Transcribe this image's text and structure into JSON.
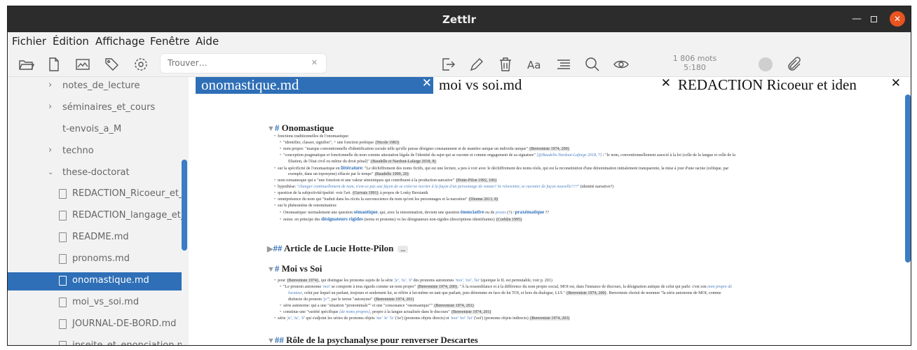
{
  "window": {
    "title": "Zettlr"
  },
  "menu": [
    "Fichier",
    "Édition",
    "Affichage",
    "Fenêtre",
    "Aide"
  ],
  "toolbar": {
    "search_placeholder": "Trouver…",
    "word_count": "1 806 mots",
    "char_count": "5:180",
    "icons": [
      "folder-open-icon",
      "new-file-icon",
      "graph-icon",
      "tags-icon",
      "settings-icon",
      "export-icon",
      "edit-icon",
      "trash-icon",
      "font-icon",
      "toc-icon",
      "search-icon",
      "preview-eye-icon",
      "attachments-icon"
    ]
  },
  "sidebar": {
    "items": [
      {
        "label": "notes_de_lecture",
        "type": "folder",
        "expanded": false
      },
      {
        "label": "séminaires_et_cours",
        "type": "folder",
        "expanded": false
      },
      {
        "label": "t-envois_a_M",
        "type": "folder-empty"
      },
      {
        "label": "techno",
        "type": "folder",
        "expanded": false
      },
      {
        "label": "these-doctorat",
        "type": "folder",
        "expanded": true
      },
      {
        "label": "REDACTION_Ricoeur_et_iden",
        "type": "file"
      },
      {
        "label": "REDACTION_langage_et_iden",
        "type": "file"
      },
      {
        "label": "README.md",
        "type": "file"
      },
      {
        "label": "pronoms.md",
        "type": "file"
      },
      {
        "label": "onomastique.md",
        "type": "file",
        "active": true
      },
      {
        "label": "moi_vs_soi.md",
        "type": "file"
      },
      {
        "label": "JOURNAL-DE-BORD.md",
        "type": "file"
      },
      {
        "label": "ipseite_et_enonciation.md",
        "type": "file"
      }
    ]
  },
  "tabs": [
    {
      "label": "onomastique.md",
      "active": true
    },
    {
      "label": "moi vs soi.md",
      "active": false
    },
    {
      "label": "REDACTION Ricoeur et iden",
      "active": false
    }
  ],
  "document": {
    "h1": "Onomastique",
    "l1": "fonctions traditionnelles de l'onomastique:",
    "l2": "\"identifier, classer, signifier\", + une fonction poétique",
    "l2c": "(Nicole 1983)",
    "l3": "nom propre: \"marque conventionnelle d'identification sociale telle qu'elle puisse désigner constamment et de manière unique un individu unique\"",
    "l3c": "(Benveniste 1974, 200)",
    "l4": "\"conception pragmatique et fonctionnelle du nom comme attestation légale de l'identité du sujet qui se raconte et comme engagement de sa signature\"",
    "l4c": "[@Baudelle.Nardout-Lafarge 2018, 7]",
    "l4b": "/ \"le nom, conventionnellement associé à la loi (celle de la langue et celle de la",
    "l5": "filiation, de l'état civil ou même du droit pénal)\"",
    "l5c": "(Baudelle et Nardout-Lafarge 2018, 8)",
    "l6a": "sur la spécificité de l'onomastique en",
    "l6k": "littérature",
    "l6b": ": \"Le déchiffrement des noms fictifs, qui est une lecture, a peu à voir avec le déchiffrement des noms réels, qui est la reconstitution d'une dénomination initialement transparente, la mise à jour d'une racine (celtique, par",
    "l7": "exemple, dans un toponyme) effacée par le temps\"",
    "l7c": "(Baudelle 1999, 20)",
    "l8": "nom romanesque qui a \"une fonction et une valeur sémiotiques qui contribuent à la production narrative\"",
    "l8c": "(Hotte-Pilon 1992, 106)",
    "l9a": "hypothèse:",
    "l9i": "\"changer continuellement de nom, n'est-ce pas une façon de se créer/se recréer à la façon d'un personnage de roman? Se réinventer, se raconter de façon nouvelle???\"",
    "l9b": "(identité narrative?)",
    "l10": "question de la subjectivité/ipséité: voir l'art.",
    "l10c": "(Gervais 1991)",
    "l10b": "à propos de Losky Bersianik",
    "l11": "omniprésence du nom qui \"traduit dans les récits la surconscience du nom qu'ont les personnages et la narration\"",
    "l11c": "(Dionne 2013, 8)",
    "l12": "sur le phénomène de renomination:",
    "l13a": "Onomastique: normalement une question",
    "l13k1": "sémantique",
    "l13b": ", qui, avec la renomination, devient une question",
    "l13k2": "énonciative",
    "l13c": "ou de",
    "l13i": "praxis",
    "l13d": "(?) /",
    "l13k3": "praxématique",
    "l13e": "??",
    "l14a": "noms: en principe des",
    "l14k": "désignateurs rigides",
    "l14b": "(noms et pronoms) vs les désignateurs non-rigides (descriptions identifiantes)",
    "l14c": "(Corblin 1995)",
    "h2": "Article de Lucie Hotte-Pilon",
    "h2more": "...",
    "h3": "Moi vs Soi",
    "m1a": "pour",
    "m1c": "(Benveniste 1974)",
    "m1b": ", qui distingue les pronoms sujets de la série",
    "m1i1": "'je', 'tu', 'il'",
    "m1d": "des pronoms autonomes",
    "m1i2": "'moi', 'toi', 'lui'",
    "m1e": "(quoique le IL est permutable, voir p. 201)",
    "m2a": "\"Le pronom autonome",
    "m2i": "'moi'",
    "m2b": "se comporte à tous égards comme un nom propre\"",
    "m2c": "(Benveniste 1974, 200)",
    "m2d": ". \"À la ressemblance et à la différence du nom propre social, MOI est, dans l'instance de discours, la désignation autique de celui qui parle: c'est son",
    "m2i2": "nom propre de",
    "m3i": "locuteur",
    "m3a": ", celui par lequel un parlant, toujours et seulement lui, se réfère à lui-même en tant que parlant, puis dénomme en face de lui TOI, et hors du dialogue, LUI.\"",
    "m3c": "(Benveniste 1974, 200)",
    "m3b": ". Benveniste choisit de nommer \"la série autonome de MOI, comme",
    "m4a": "distincte du pronom",
    "m4i": "'je'",
    "m4b": "\", par le terme \"autonyme\"",
    "m4c": "(Benveniste 1974, 201)",
    "m5a": "série autonome: qui a une \"situation \"pronominale\"\" et une \"consonance \"onomastique\"\"",
    "m5c": "(Benveniste 1974, 201)",
    "m6a": "constitue une \"variété spécifique",
    "m6i": "[de noms propres]",
    "m6b": ", propre à la langue actualisée dans le discours\"",
    "m6c": "(Benveniste 1974, 201)",
    "m7a": "série",
    "m7i1": "'je', 'tu', 'il'",
    "m7b": "qui s'adjoint les séries de pronoms objets",
    "m7i2": "'me' 'te' 'le'",
    "m7c": "('se') (pronoms objets directs) et",
    "m7i3": "'moi' 'toi' 'lui'",
    "m7d": "('soi') (pronoms objets indirects)",
    "m7e": "(Benveniste 1974, 203)",
    "h4": "Rôle de la psychanalyse pour renverser Descartes"
  },
  "colors": {
    "accent": "#2e6fb7",
    "titlebar": "#2c2c2c",
    "close": "#e95420"
  }
}
